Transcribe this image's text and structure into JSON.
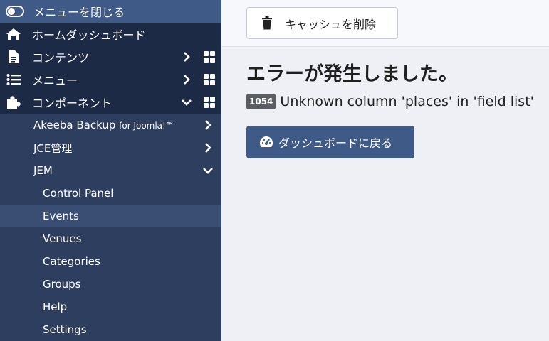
{
  "sidebar": {
    "toggle_label": "メニューを閉じる",
    "items": [
      {
        "label": "ホームダッシュボード",
        "icon": "home-icon"
      },
      {
        "label": "コンテンツ",
        "icon": "file-icon"
      },
      {
        "label": "メニュー",
        "icon": "list-icon"
      },
      {
        "label": "コンポーネント",
        "icon": "puzzle-icon"
      }
    ],
    "components": [
      {
        "label": "Akeeba Backup",
        "suffix": "for Joomla!™"
      },
      {
        "label": "JCE管理"
      },
      {
        "label": "JEM"
      }
    ],
    "jem_items": [
      {
        "label": "Control Panel"
      },
      {
        "label": "Events"
      },
      {
        "label": "Venues"
      },
      {
        "label": "Categories"
      },
      {
        "label": "Groups"
      },
      {
        "label": "Help"
      },
      {
        "label": "Settings"
      }
    ]
  },
  "toolbar": {
    "clear_cache_label": "キャッシュを削除"
  },
  "error": {
    "title": "エラーが発生しました。",
    "code": "1054",
    "message": "Unknown column 'places' in 'field list'"
  },
  "dashboard_button": {
    "label": "ダッシュボードに戻る"
  },
  "colors": {
    "sidebar_bg": "#1c2a45",
    "sidebar_sub_bg": "#2d3e5e",
    "accent": "#405a87",
    "page_bg": "#eef0f5"
  }
}
